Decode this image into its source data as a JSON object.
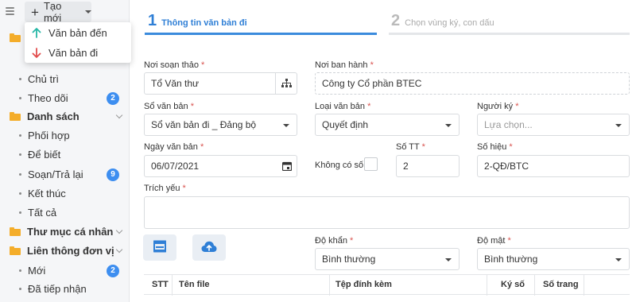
{
  "toolbar": {
    "create_label": "Tạo mới"
  },
  "create_menu": {
    "incoming_label": "Văn bản đến",
    "outgoing_label": "Văn bản đi"
  },
  "sidebar": {
    "main": {
      "item_chutri": "Chủ trì",
      "item_theodoi": "Theo dõi",
      "theodoi_count": "2"
    },
    "danh_sach": {
      "title": "Danh sách",
      "items": [
        {
          "label": "Phối hợp",
          "count": ""
        },
        {
          "label": "Để biết",
          "count": ""
        },
        {
          "label": "Soạn/Trả lại",
          "count": "9"
        },
        {
          "label": "Kết thúc",
          "count": ""
        },
        {
          "label": "Tất cả",
          "count": ""
        }
      ]
    },
    "personal": {
      "title": "Thư mục cá nhân"
    },
    "lien_thong": {
      "title": "Liên thông đơn vị",
      "items": [
        {
          "label": "Mới",
          "count": "2"
        },
        {
          "label": "Đã tiếp nhận",
          "count": ""
        }
      ]
    }
  },
  "steps": [
    {
      "number": "1",
      "label": "Thông tin văn bản đi"
    },
    {
      "number": "2",
      "label": "Chọn vùng ký, con dấu"
    }
  ],
  "form": {
    "noi_soan_thao": {
      "label": "Nơi soạn thảo",
      "value": "Tổ Văn thư"
    },
    "noi_ban_hanh": {
      "label": "Nơi ban hành",
      "value": "Công ty Cổ phần BTEC"
    },
    "so_van_ban": {
      "label": "Sổ văn bản",
      "value": "Sổ văn bản đi _ Đảng bộ"
    },
    "loai_van_ban": {
      "label": "Loại văn bản",
      "value": "Quyết định"
    },
    "nguoi_ky": {
      "label": "Người ký",
      "placeholder": "Lựa chọn..."
    },
    "ngay_van_ban": {
      "label": "Ngày văn bản",
      "value": "06/07/2021"
    },
    "khong_co_so": {
      "label": "Không có số"
    },
    "so_tt": {
      "label": "Số TT",
      "value": "2"
    },
    "so_hieu": {
      "label": "Số hiệu",
      "value": "2-QĐ/BTC"
    },
    "trich_yeu": {
      "label": "Trích yếu"
    },
    "do_khan": {
      "label": "Độ khẩn",
      "value": "Bình thường"
    },
    "do_mat": {
      "label": "Độ mật",
      "value": "Bình thường"
    },
    "required_mark": "*"
  },
  "table": {
    "headers": {
      "stt": "STT",
      "ten_file": "Tên file",
      "tep_dinh_kem": "Tệp đính kèm",
      "ky_so": "Ký số",
      "so_trang": "Số trang"
    }
  },
  "colors": {
    "accent": "#2f7fd6",
    "badge": "#3d8ef0",
    "folder": "#f4ad2a",
    "required": "#d9534f",
    "arrow_in": "#26b7a6",
    "arrow_out": "#e24c4c"
  }
}
